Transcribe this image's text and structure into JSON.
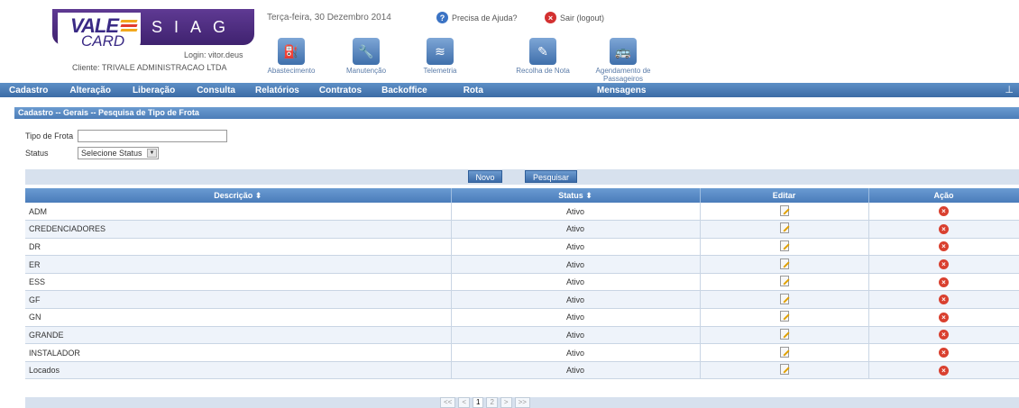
{
  "header": {
    "logo_brand": "VALE",
    "logo_card": "CARD",
    "logo_system": "SIAG",
    "login": "Login: vitor.deus",
    "client": "Cliente: TRIVALE ADMINISTRACAO LTDA",
    "date": "Terça-feira, 30 Dezembro 2014",
    "help": "Precisa de Ajuda?",
    "logout": "Sair (logout)"
  },
  "modules": [
    {
      "label": "Abastecimento",
      "icon": "fuel-pump-icon"
    },
    {
      "label": "Manutenção",
      "icon": "wrench-icon"
    },
    {
      "label": "Telemetria",
      "icon": "signal-icon"
    },
    {
      "label": "Recolha de Nota",
      "icon": "receipt-icon"
    },
    {
      "label": "Agendamento de Passageiros",
      "icon": "bus-icon"
    }
  ],
  "nav": {
    "items": [
      "Cadastro",
      "Alteração",
      "Liberação",
      "Consulta",
      "Relatórios",
      "Contratos",
      "Backoffice",
      "Rota",
      "Mensagens"
    ]
  },
  "breadcrumb": "Cadastro -- Gerais -- Pesquisa de Tipo de Frota",
  "form": {
    "tipo_label": "Tipo de Frota",
    "tipo_value": "",
    "status_label": "Status",
    "status_selected": "Selecione Status"
  },
  "buttons": {
    "novo": "Novo",
    "pesquisar": "Pesquisar"
  },
  "table": {
    "headers": [
      "Descrição",
      "Status",
      "Editar",
      "Ação"
    ],
    "rows": [
      {
        "descricao": "ADM",
        "status": "Ativo"
      },
      {
        "descricao": "CREDENCIADORES",
        "status": "Ativo"
      },
      {
        "descricao": "DR",
        "status": "Ativo"
      },
      {
        "descricao": "ER",
        "status": "Ativo"
      },
      {
        "descricao": "ESS",
        "status": "Ativo"
      },
      {
        "descricao": "GF",
        "status": "Ativo"
      },
      {
        "descricao": "GN",
        "status": "Ativo"
      },
      {
        "descricao": "GRANDE",
        "status": "Ativo"
      },
      {
        "descricao": "INSTALADOR",
        "status": "Ativo"
      },
      {
        "descricao": "Locados",
        "status": "Ativo"
      }
    ]
  },
  "pager": {
    "first": "<<",
    "prev": "<",
    "pages": [
      "1",
      "2"
    ],
    "next": ">",
    "last": ">>"
  },
  "colors": {
    "nav_blue": "#4a7cba",
    "logo_purple": "#4b2c82",
    "row_alt": "#eef3fa",
    "delete_red": "#d9402f"
  }
}
